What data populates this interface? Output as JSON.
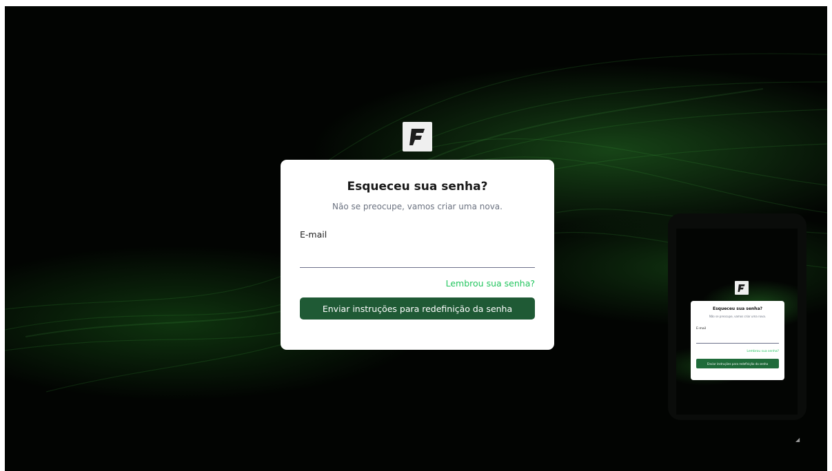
{
  "logo": {
    "letter": "F",
    "icon": "f-logo-icon"
  },
  "card": {
    "title": "Esqueceu sua senha?",
    "subtitle": "Não se preocupe, vamos criar uma nova.",
    "email_label": "E-mail",
    "email_value": "",
    "email_placeholder": "",
    "forgot_link": "Lembrou sua senha?",
    "submit_label": "Enviar instruções para redefinição da senha"
  },
  "mobile_preview": {
    "logo_letter": "F",
    "title": "Esqueceu sua senha?",
    "subtitle": "Não se preocupe, vamos criar uma nova.",
    "email_label": "E-mail",
    "forgot_link": "Lembrou sua senha?",
    "submit_label": "Enviar instruções para redefinição da senha"
  },
  "colors": {
    "background": "#020402",
    "accent_green": "#22c55e",
    "button_green": "#1f5a35",
    "card": "#ffffff"
  }
}
